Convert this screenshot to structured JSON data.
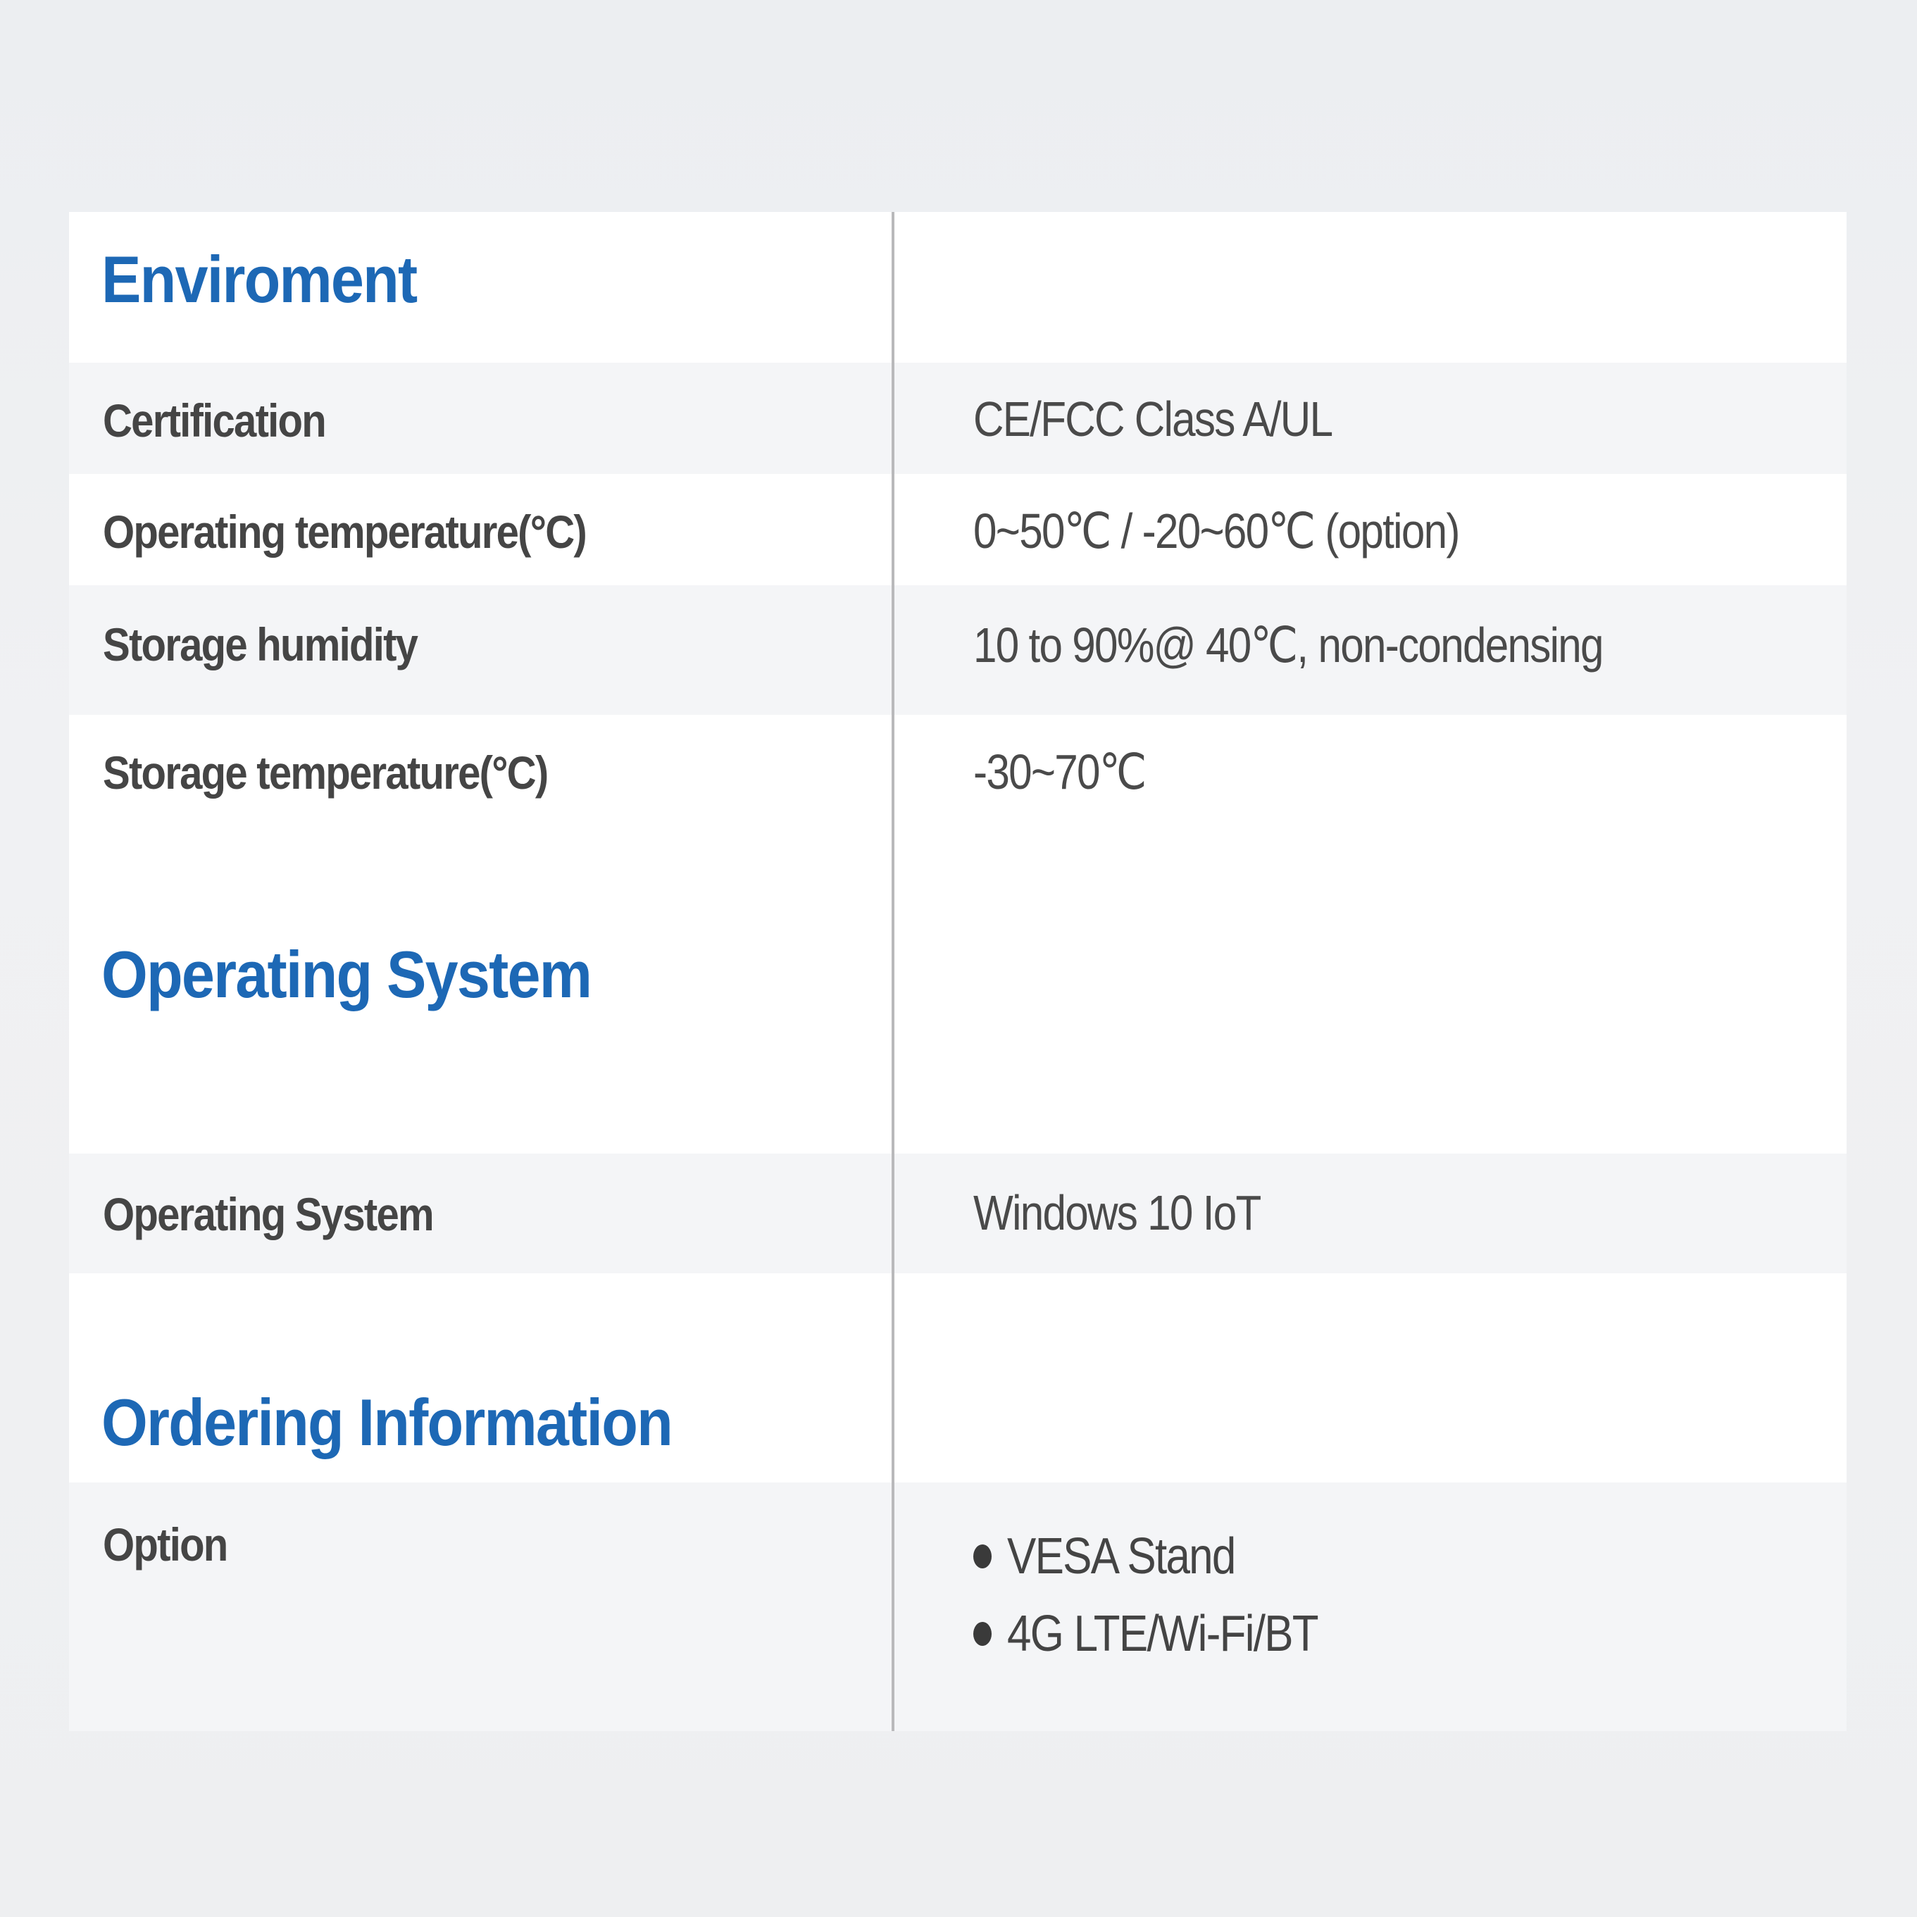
{
  "sections": [
    {
      "title": "Enviroment",
      "rows": [
        {
          "label": "Certification",
          "value": "CE/FCC Class A/UL"
        },
        {
          "label": "Operating temperature(°C)",
          "value": "0~50℃ / -20~60℃ (option)"
        },
        {
          "label": "Storage humidity",
          "value": "10 to 90%@ 40℃, non-condensing"
        },
        {
          "label": "Storage temperature(°C)",
          "value": "-30~70℃"
        }
      ]
    },
    {
      "title": "Operating System",
      "rows": [
        {
          "label": "Operating System",
          "value": "Windows 10 IoT"
        }
      ]
    },
    {
      "title": "Ordering Information",
      "rows": [
        {
          "label": "Option",
          "items": [
            "VESA Stand",
            "4G LTE/Wi-Fi/BT"
          ]
        }
      ]
    }
  ],
  "colors": {
    "heading": "#1d68b5",
    "label": "#454545",
    "value": "#4a4a4a",
    "row_shade": "#f4f5f7",
    "divider": "#b9b9bb"
  }
}
